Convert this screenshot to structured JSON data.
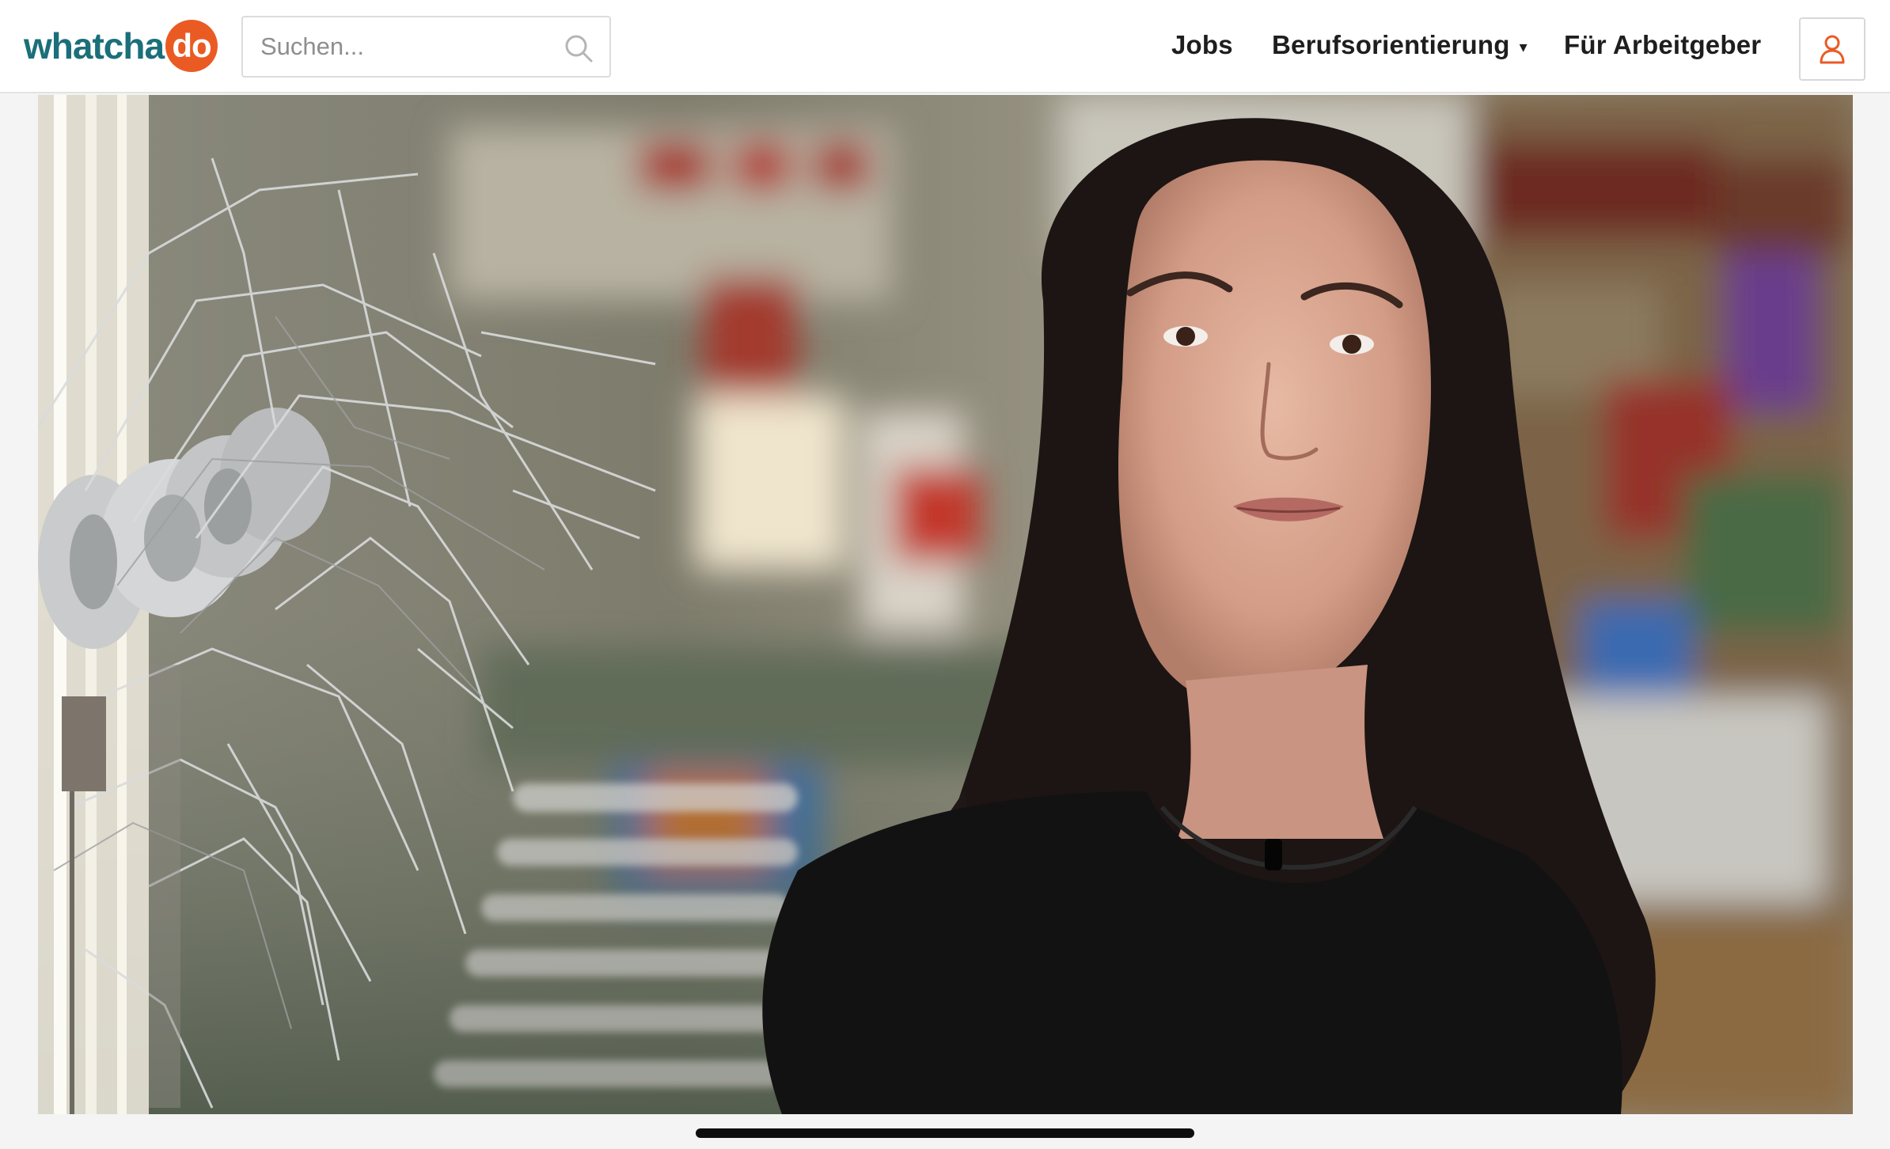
{
  "header": {
    "logo": {
      "text": "whatcha",
      "badge": "do"
    },
    "search": {
      "placeholder": "Suchen...",
      "value": ""
    },
    "nav": {
      "jobs": "Jobs",
      "berufsorientierung": "Berufsorientierung",
      "berufsorientierung_caret": "▾",
      "arbeitgeber": "Für Arbeitgeber"
    },
    "icons": {
      "search": "search-icon",
      "user": "user-icon"
    }
  },
  "colors": {
    "brand_teal": "#1b6f7a",
    "brand_orange": "#ea5b24"
  },
  "video": {
    "subject": "video-frame"
  }
}
